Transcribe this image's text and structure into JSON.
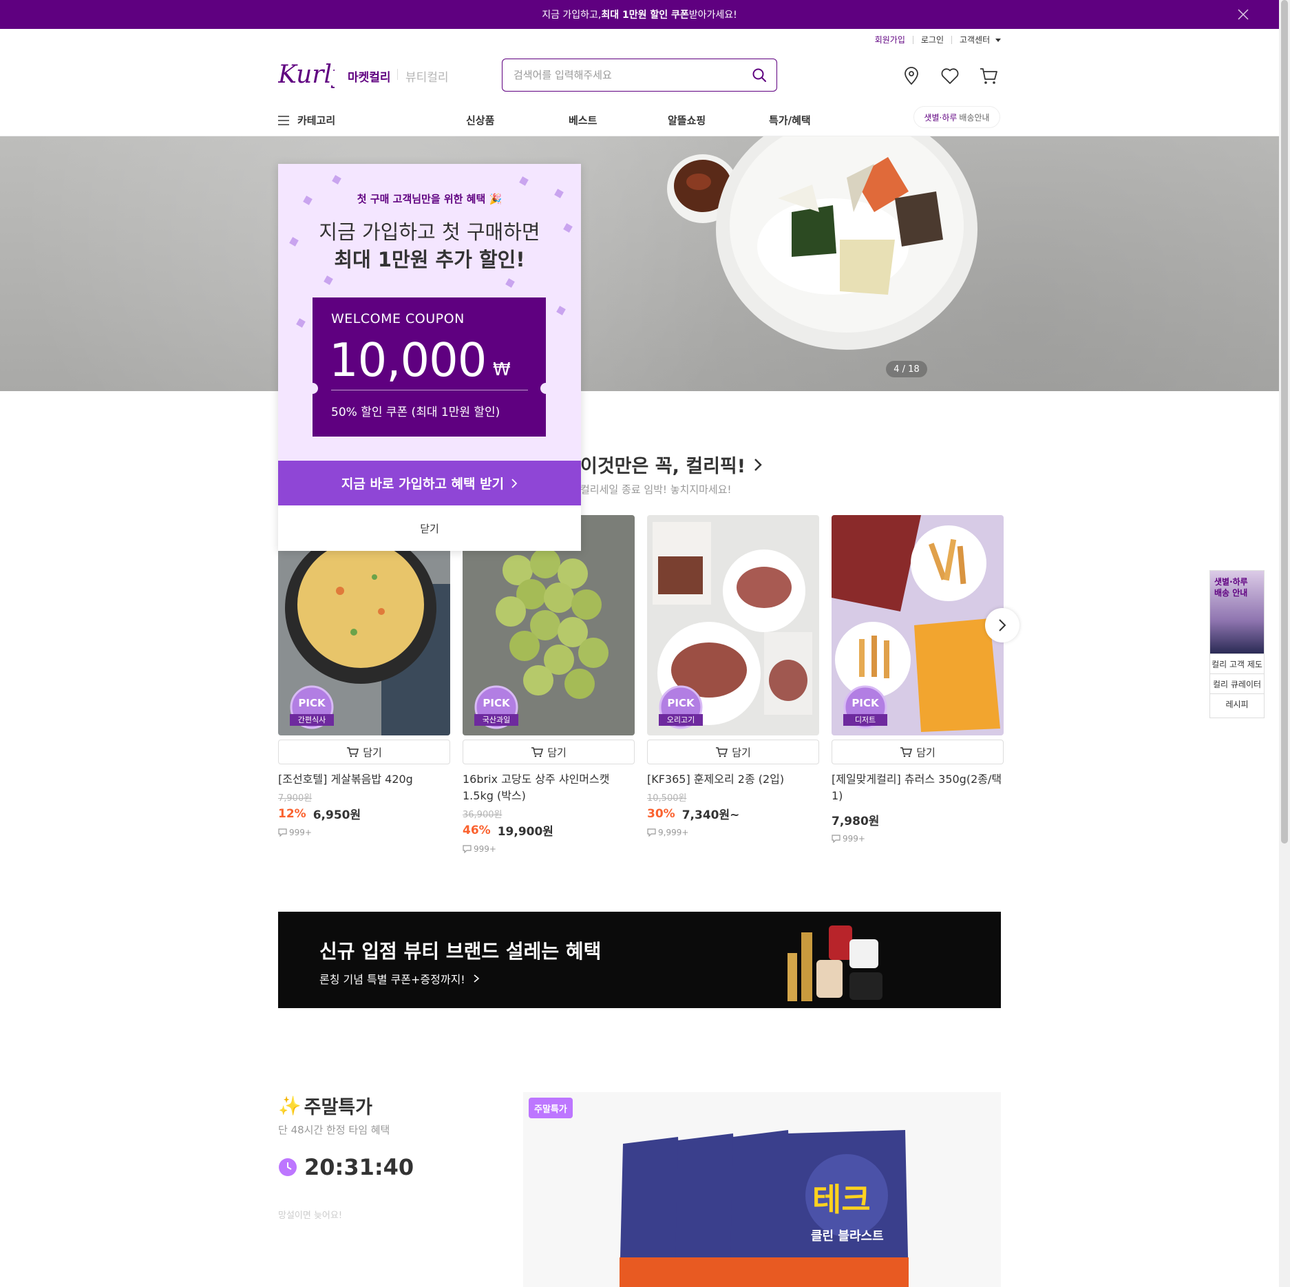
{
  "top_banner": {
    "text_prefix": "지금 가입하고, ",
    "text_bold": "최대 1만원 할인 쿠폰",
    "text_suffix": " 받아가세요!"
  },
  "header": {
    "util_links": [
      "회원가입",
      "로그인",
      "고객센터"
    ],
    "brand": "Kurly",
    "market_tab": "마켓컬리",
    "beauty_tab": "뷰티컬리",
    "search_placeholder": "검색어를 입력해주세요"
  },
  "gnb": {
    "category_label": "카테고리",
    "menu": [
      "신상품",
      "베스트",
      "알뜰쇼핑",
      "특가/혜택"
    ],
    "delivery_em": "샛별·하루",
    "delivery_label": "배송안내"
  },
  "hero": {
    "counter": "4 / 18"
  },
  "popup": {
    "eyebrow": "첫 구매 고객님만을 위한 혜택 🎉",
    "headline_line1": "지금 가입하고 첫 구매하면",
    "headline_line2": "최대 1만원 추가 할인!",
    "coupon_label": "WELCOME COUPON",
    "coupon_amount": "10,000",
    "coupon_currency": "₩",
    "coupon_desc": "50% 할인 쿠폰 (최대 1만원 할인)",
    "cta": "지금 바로 가입하고 혜택 받기",
    "close": "닫기"
  },
  "picks": {
    "title": "이것만은 꼭, 컬리픽!",
    "subtitle": "컬리세일 종료 임박! 놓치지마세요!",
    "badge_text": "PICK",
    "cart_label": "담기",
    "products": [
      {
        "name": "[조선호텔] 게살볶음밥 420g",
        "tag": "간편식사",
        "original_price": "7,900원",
        "discount": "12%",
        "price": "6,950원",
        "reviews": "999+"
      },
      {
        "name": "16brix 고당도 상주 샤인머스캣 1.5kg (박스)",
        "tag": "국산과일",
        "original_price": "36,900원",
        "discount": "46%",
        "price": "19,900원",
        "reviews": "999+"
      },
      {
        "name": "[KF365] 훈제오리 2종 (2입)",
        "tag": "오리고기",
        "original_price": "10,500원",
        "discount": "30%",
        "price": "7,340원~",
        "reviews": "9,999+"
      },
      {
        "name": "[제일맞게컬리] 츄러스 350g(2종/택 1)",
        "tag": "디저트",
        "original_price": "",
        "discount": "",
        "price": "7,980원",
        "reviews": "999+"
      }
    ]
  },
  "beauty_banner": {
    "title": "신규 입점 뷰티 브랜드 설레는 혜택",
    "subtitle": "론칭 기념 특별 쿠폰+증정까지!"
  },
  "weekend": {
    "title": "주말특가",
    "subtitle": "단 48시간 한정 타임 혜택",
    "timer": "20:31:40",
    "note": "망설이면 늦어요!",
    "badge": "주말특가",
    "product_brand": "테크",
    "product_line": "클린 블라스트"
  },
  "side_banner": {
    "image_text": "샛별·하루\n배송 안내",
    "links": [
      "컬리 고객 제도",
      "컬리 큐레이터",
      "레시피"
    ]
  },
  "colors": {
    "brand_purple": "#5f0080",
    "cta_purple": "#8f46d6",
    "discount_orange": "#fa622f",
    "popup_bg": "#f4e6ff"
  }
}
